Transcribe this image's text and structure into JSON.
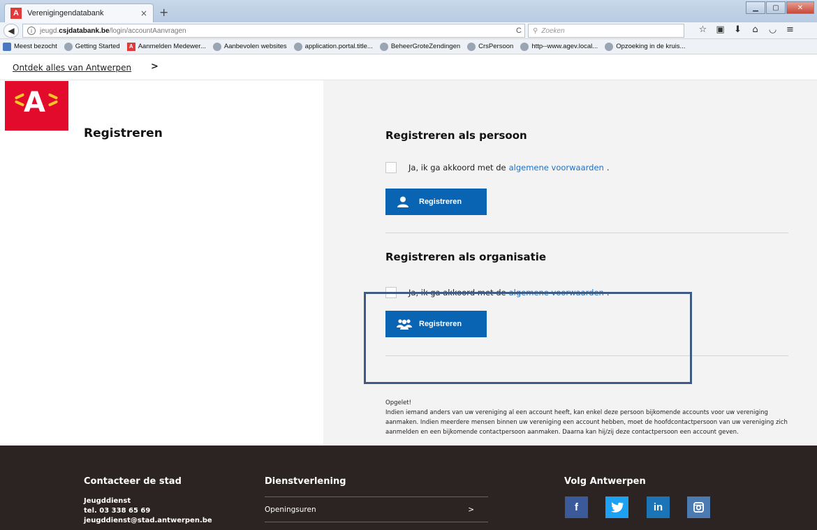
{
  "browser": {
    "tab_title": "Verenigingendatabank",
    "tab_favicon": "A",
    "tab_close": "×",
    "new_tab": "+",
    "url_domain": "jeugd.csjdatabank.be",
    "url_path": "/login/accountAanvragen",
    "url_prefix": "jeugd.",
    "url_domain_bold": "csjdatabank.be",
    "search_placeholder": "Zoeken",
    "bookmarks": [
      "Meest bezocht",
      "Getting Started",
      "Aanmelden Medewer...",
      "Aanbevolen websites",
      "application.portal.title...",
      "BeheerGroteZendingen",
      "CrsPersoon",
      "http--www.agev.local...",
      "Opzoeking in de kruis..."
    ]
  },
  "topnav": {
    "link": "Ontdek alles van Antwerpen",
    "arrow": ">"
  },
  "page": {
    "title": "Registreren"
  },
  "person": {
    "heading": "Registreren als persoon",
    "check_text": "Ja, ik ga akkoord met de",
    "check_link": "algemene voorwaarden",
    "check_end": ".",
    "button": "Registreren"
  },
  "organisation": {
    "heading": "Registreren als organisatie",
    "check_text": "Ja, ik ga akkoord met de",
    "check_link": "algemene voorwaarden",
    "check_end": ".",
    "button": "Registreren"
  },
  "note": {
    "title": "Opgelet!",
    "body": "Indien iemand anders van uw vereniging al een account heeft, kan enkel deze persoon bijkomende accounts voor uw vereniging aanmaken. Indien meerdere mensen binnen uw vereniging een account hebben, moet de hoofdcontactpersoon van uw vereniging zich aanmelden en een bijkomende contactpersoon aanmaken. Daarna kan hij/zij deze contactpersoon een account geven."
  },
  "footer": {
    "contact_heading": "Contacteer de stad",
    "contact_name": "Jeugddienst",
    "contact_tel": "tel. 03 338 65 69",
    "contact_email": "jeugddienst@stad.antwerpen.be",
    "service_heading": "Dienstverlening",
    "service_link": "Openingsuren",
    "service_arrow": ">",
    "follow_heading": "Volg Antwerpen",
    "social": [
      "f",
      "in"
    ]
  },
  "colors": {
    "brand_red": "#e30b2c",
    "button_blue": "#0a64b4",
    "link_blue": "#1f6fc2",
    "footer_bg": "#2c2423"
  }
}
